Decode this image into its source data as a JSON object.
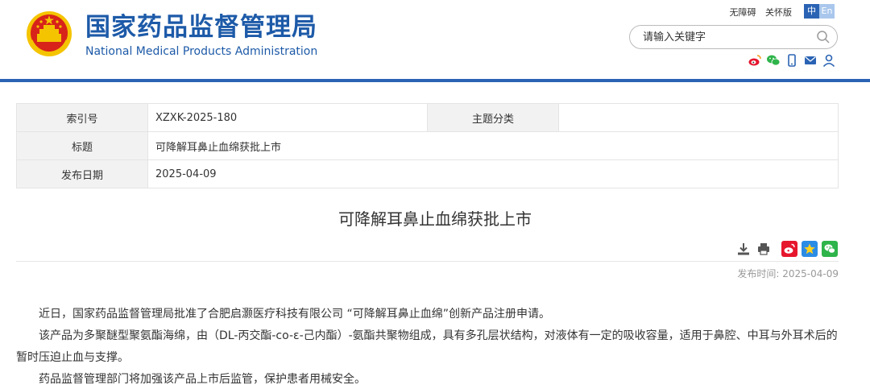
{
  "header": {
    "org_name_cn": "国家药品监督管理局",
    "org_name_en": "National Medical Products Administration",
    "top_links": {
      "accessibility": "无障碍",
      "elder_mode": "关怀版"
    },
    "language": {
      "chinese": "中",
      "english": "En",
      "active": "中"
    },
    "search": {
      "placeholder": "请输入关键字"
    },
    "social_icons": [
      "weibo-icon",
      "wechat-icon",
      "mobile-icon",
      "mail-icon",
      "user-icon"
    ]
  },
  "info_table": {
    "index_label": "索引号",
    "index_value": "XZXK-2025-180",
    "topic_label": "主题分类",
    "topic_value": "",
    "title_label": "标题",
    "title_value": "可降解耳鼻止血绵获批上市",
    "date_label": "发布日期",
    "date_value": "2025-04-09"
  },
  "article": {
    "title": "可降解耳鼻止血绵获批上市",
    "publish_time": "发布时间:  2025-04-09",
    "tools": [
      "download-icon",
      "print-icon"
    ],
    "share": [
      "weibo-share-icon",
      "qzone-share-icon",
      "wechat-share-icon"
    ],
    "paragraphs": [
      "近日，国家药品监督管理局批准了合肥启灏医疗科技有限公司 “可降解耳鼻止血绵”创新产品注册申请。",
      "该产品为多聚醚型聚氨酯海绵，由（DL-丙交酯-co-ε-己内酯）-氨酯共聚物组成，具有多孔层状结构，对液体有一定的吸收容量，适用于鼻腔、中耳与外耳术后的暂时压迫止血与支撑。",
      "药品监督管理部门将加强该产品上市后监管，保护患者用械安全。"
    ]
  },
  "colors": {
    "brand_blue": "#1d5aa8",
    "header_bar": "#2a63b4",
    "emblem_red": "#d7231a",
    "emblem_gold": "#f5c400"
  }
}
